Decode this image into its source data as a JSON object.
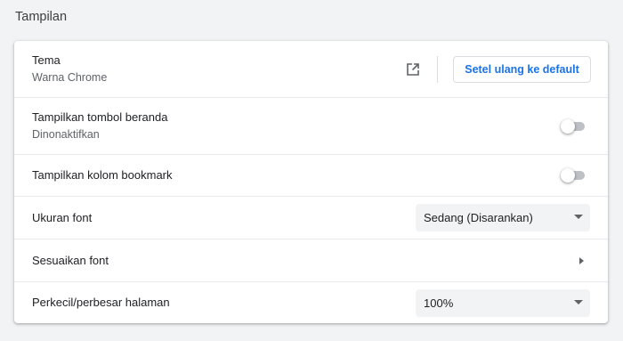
{
  "section": {
    "title": "Tampilan"
  },
  "theme": {
    "label": "Tema",
    "value": "Warna Chrome",
    "open_icon": "open-in-new-icon",
    "reset_label": "Setel ulang ke default"
  },
  "home_button": {
    "label": "Tampilkan tombol beranda",
    "status": "Dinonaktifkan",
    "enabled": false
  },
  "bookmarks_bar": {
    "label": "Tampilkan kolom bookmark",
    "enabled": false
  },
  "font_size": {
    "label": "Ukuran font",
    "selected": "Sedang (Disarankan)"
  },
  "customize_fonts": {
    "label": "Sesuaikan font",
    "icon": "chevron-right-icon"
  },
  "page_zoom": {
    "label": "Perkecil/perbesar halaman",
    "selected": "100%"
  },
  "colors": {
    "accent": "#1a73e8",
    "background": "#f1f3f4",
    "card": "#ffffff",
    "toggle_off": "#bdc1c6"
  }
}
